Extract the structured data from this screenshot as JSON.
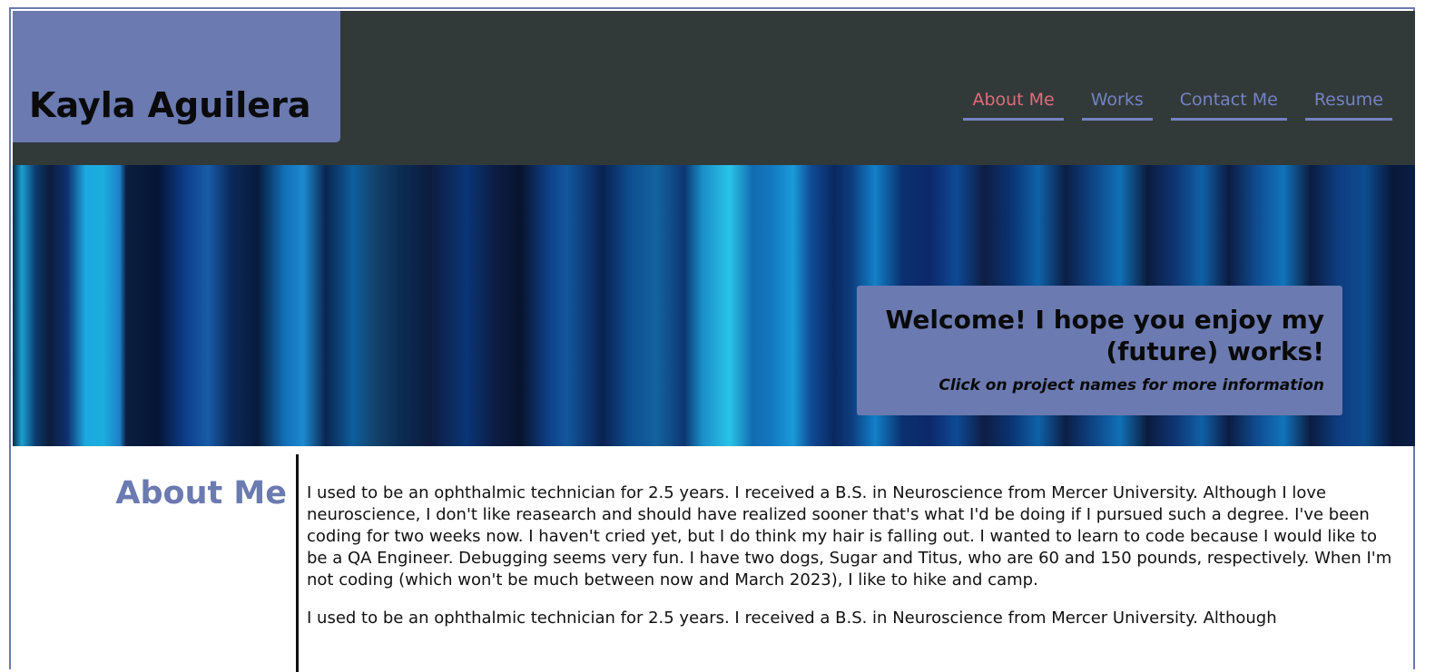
{
  "header": {
    "site_title": "Kayla Aguilera",
    "nav": [
      {
        "label": "About Me",
        "active": true
      },
      {
        "label": "Works",
        "active": false
      },
      {
        "label": "Contact Me",
        "active": false
      },
      {
        "label": "Resume",
        "active": false
      }
    ]
  },
  "hero": {
    "welcome_heading": "Welcome! I hope you enjoy my (future) works!",
    "welcome_subtext": "Click on project names for more information"
  },
  "about": {
    "heading": "About Me",
    "paragraphs": [
      "I used to be an ophthalmic technician for 2.5 years. I received a B.S. in Neuroscience from Mercer University. Although I love neuroscience, I don't like reasearch and should have realized sooner that's what I'd be doing if I pursued such a degree. I've been coding for two weeks now. I haven't cried yet, but I do think my hair is falling out. I wanted to learn to code because I would like to be a QA Engineer. Debugging seems very fun. I have two dogs, Sugar and Titus, who are 60 and 150 pounds, respectively. When I'm not coding (which won't be much between now and March 2023), I like to hike and camp.",
      "I used to be an ophthalmic technician for 2.5 years. I received a B.S. in Neuroscience from Mercer University. Although"
    ]
  },
  "colors": {
    "accent": "#6b7ab0",
    "header_bg": "#323939",
    "nav_link": "#7483c2",
    "nav_active": "#e26b7b"
  }
}
